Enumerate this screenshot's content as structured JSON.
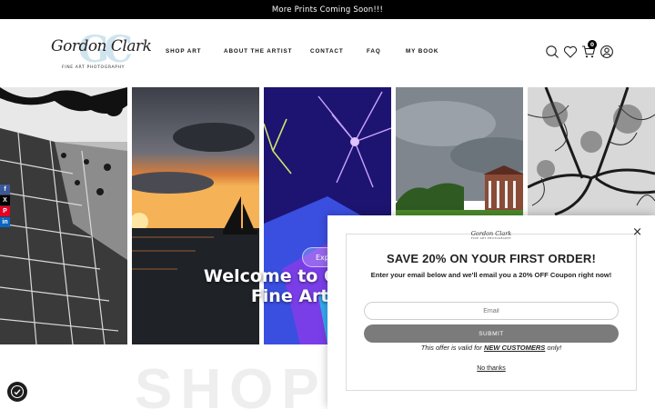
{
  "announcement": {
    "text": "More Prints Coming Soon!!!"
  },
  "brand": {
    "monogram": "GC",
    "script_name": "Gordon Clark",
    "tagline": "FINE ART PHOTOGRAPHY"
  },
  "nav": {
    "items": [
      {
        "label": "SHOP ART"
      },
      {
        "label": "ABOUT THE ARTIST"
      },
      {
        "label": "CONTACT"
      },
      {
        "label": "FAQ"
      },
      {
        "label": "MY BOOK"
      }
    ]
  },
  "header_icons": {
    "search": "search-icon",
    "wishlist": "heart-icon",
    "cart": "cart-icon",
    "cart_count": "0",
    "account": "user-icon"
  },
  "hero": {
    "title_line1": "Welcome to Gordon Clark",
    "title_line2": "Fine Art Gallery",
    "button_label": "Exp"
  },
  "social": [
    "f",
    "X",
    "P",
    "in"
  ],
  "section_heading": "SHOP",
  "popup": {
    "mini_logo": "Gordon Clark",
    "mini_tagline": "FINE ART PHOTOGRAPHY",
    "headline": "SAVE 20% ON YOUR FIRST ORDER!",
    "subtext": "Enter your email below and we'll email you a 20% OFF Coupon right now!",
    "email_placeholder": "Email",
    "submit_label": "SUBMIT",
    "offer_prefix": "This offer is valid for ",
    "offer_emphasis": "NEW CUSTOMERS",
    "offer_suffix": " only!",
    "dismiss_label": "No thanks",
    "close_label": "×"
  },
  "colors": {
    "announcement_bg": "#000000",
    "submit_bg": "#7b7b7b",
    "monogram": "#cfe4ee"
  }
}
